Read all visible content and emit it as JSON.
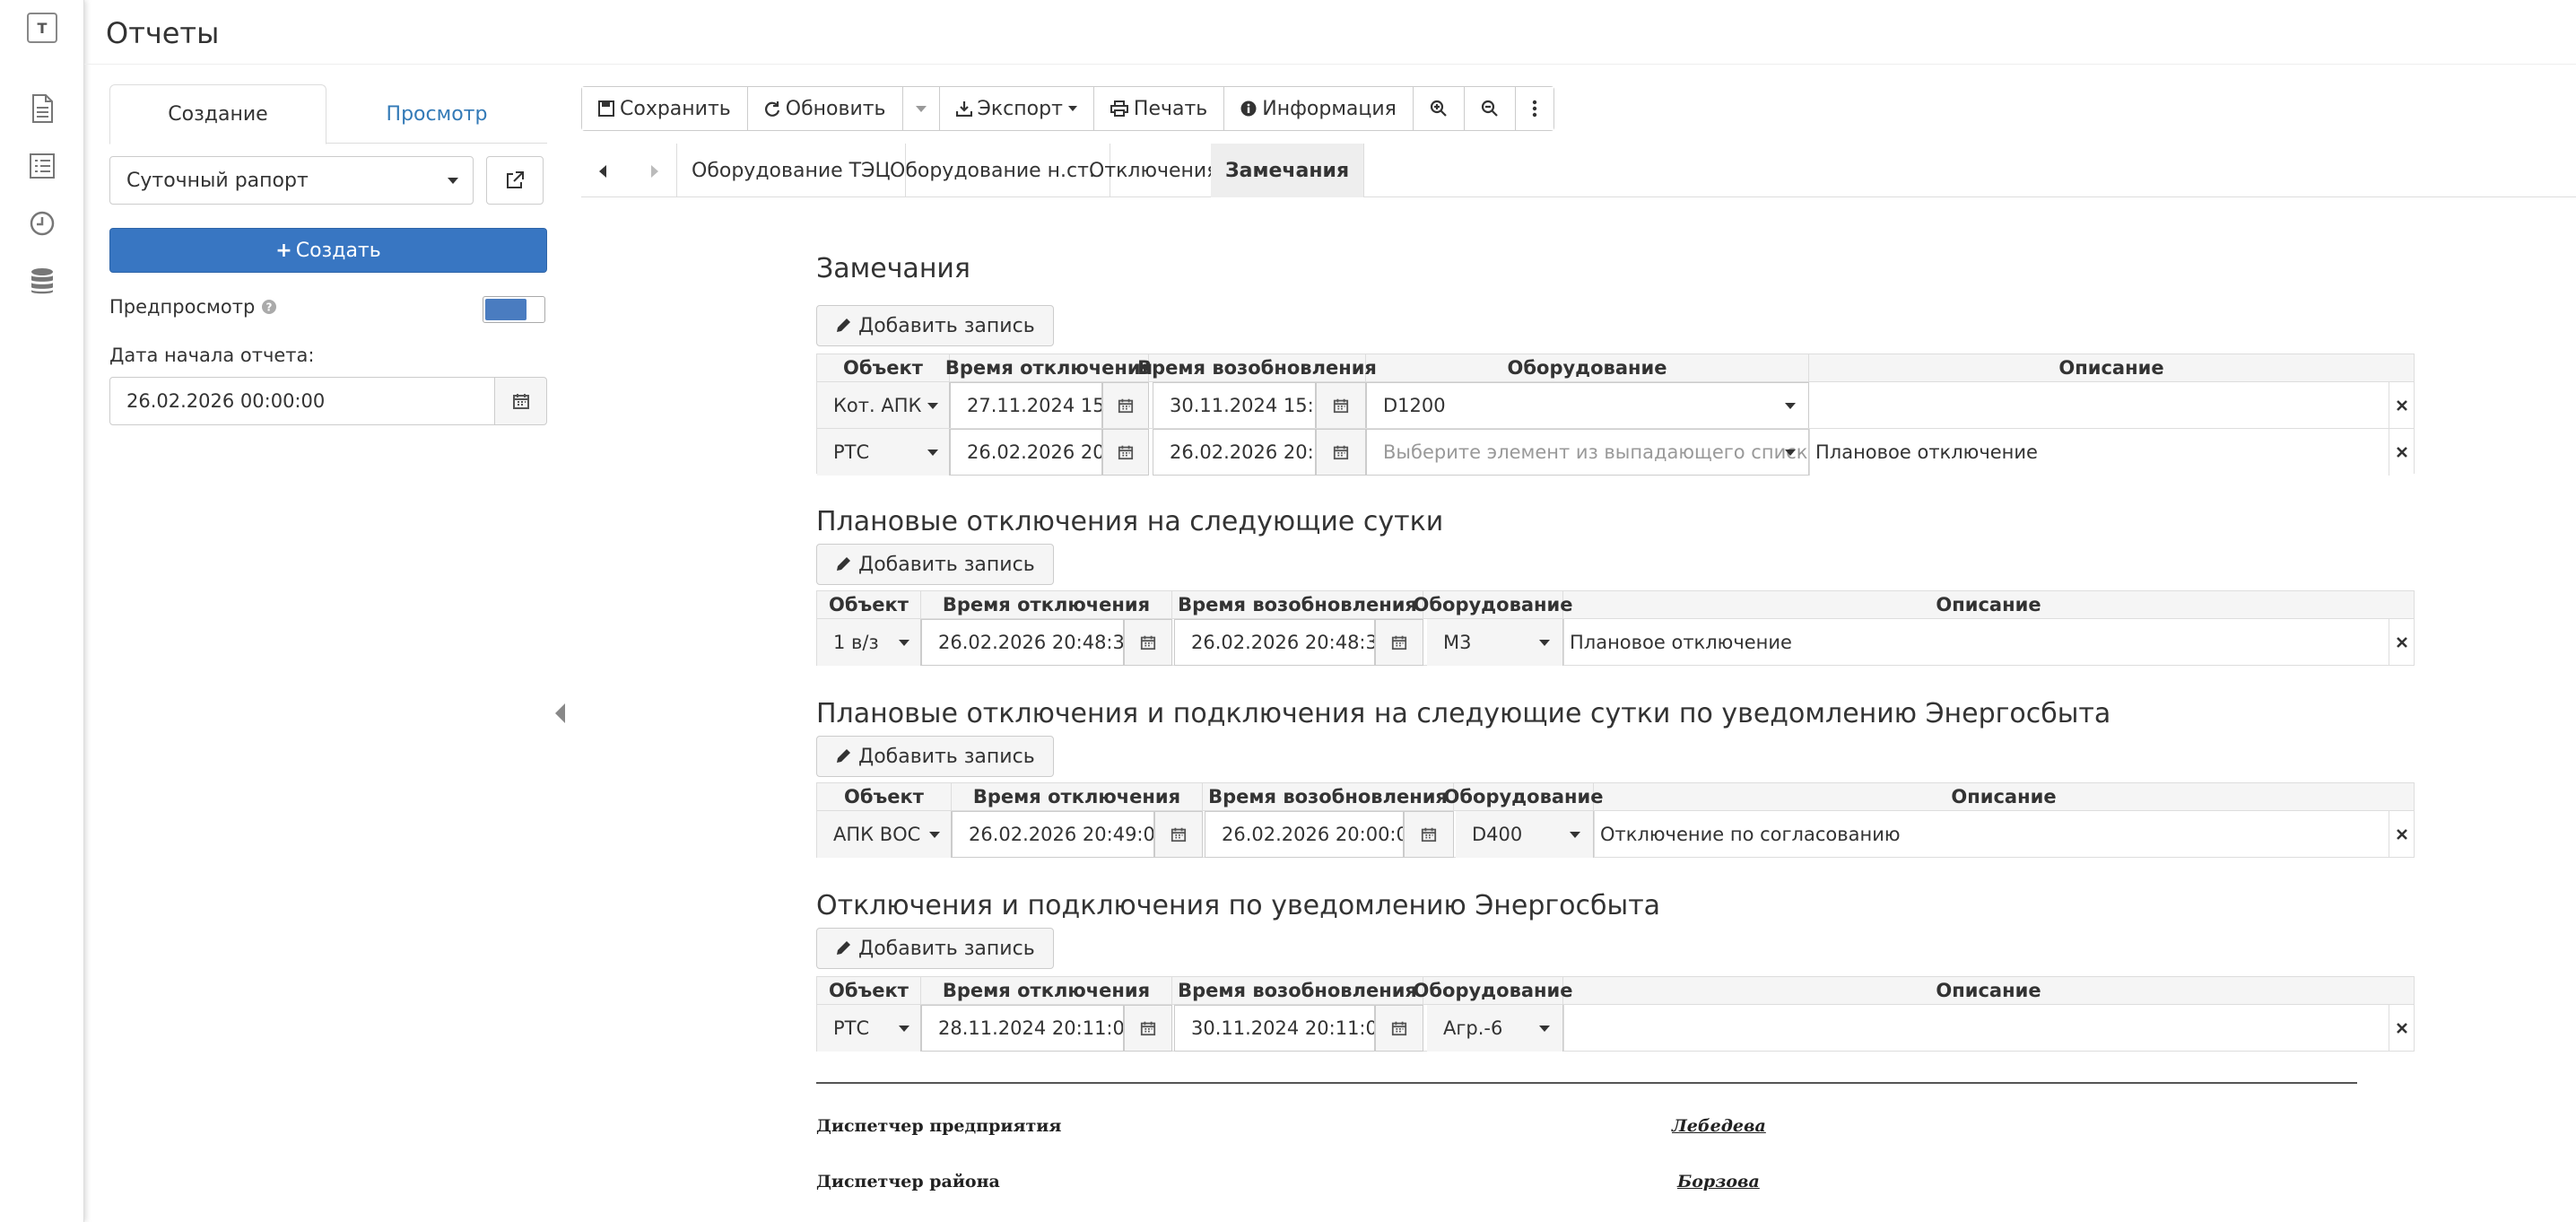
{
  "app": {
    "logo_letter": "T",
    "title": "Отчеты"
  },
  "rail": {
    "icons": [
      "document-icon",
      "list-icon",
      "clock-icon",
      "database-icon"
    ]
  },
  "sidebar": {
    "tabs": [
      {
        "label": "Создание",
        "active": true
      },
      {
        "label": "Просмотр",
        "active": false
      }
    ],
    "report_type": "Суточный рапорт",
    "create_label": "Создать",
    "preview_label": "Предпросмотр",
    "preview_enabled": true,
    "start_date_label": "Дата начала отчета:",
    "start_date_value": "26.02.2026 00:00:00"
  },
  "toolbar": {
    "save": "Сохранить",
    "refresh": "Обновить",
    "export": "Экспорт",
    "print": "Печать",
    "info": "Информация"
  },
  "report_tabs": [
    {
      "label": "Оборудование ТЭЦ",
      "active": false
    },
    {
      "label": "Оборудование н.ст.",
      "active": false
    },
    {
      "label": "Отключения",
      "active": false
    },
    {
      "label": "Замечания",
      "active": true
    }
  ],
  "add_record_label": "Добавить запись",
  "sections": [
    {
      "title": "Замечания",
      "headers": [
        "Объект",
        "Время отключения",
        "Время возобновления",
        "Оборудование",
        "Описание"
      ],
      "rows": [
        {
          "object": "Кот. АПК",
          "off_time": "27.11.2024 15",
          "on_time": "30.11.2024 15:",
          "equipment": "D1200",
          "description": ""
        },
        {
          "object": "РТС",
          "off_time": "26.02.2026 20",
          "on_time": "26.02.2026 20:",
          "equipment": "",
          "equipment_placeholder": "Выберите элемент из выпадающего списка...",
          "description": "Плановое отключение"
        }
      ]
    },
    {
      "title": "Плановые отключения на следующие сутки",
      "headers": [
        "Объект",
        "Время отключения",
        "Время возобновления",
        "Оборудование",
        "Описание"
      ],
      "rows": [
        {
          "object": "1 в/з",
          "off_time": "26.02.2026 20:48:3",
          "on_time": "26.02.2026 20:48:3",
          "equipment": "М3",
          "description": "Плановое отключение"
        }
      ]
    },
    {
      "title": "Плановые отключения и подключения на следующие сутки по уведомлению Энергосбыта",
      "headers": [
        "Объект",
        "Время отключения",
        "Время возобновления",
        "Оборудование",
        "Описание"
      ],
      "rows": [
        {
          "object": "АПК ВОС",
          "off_time": "26.02.2026 20:49:0",
          "on_time": "26.02.2026 20:00:0",
          "equipment": "D400",
          "description": "Отключение по согласованию"
        }
      ]
    },
    {
      "title": "Отключения и подключения по уведомлению Энергосбыта",
      "headers": [
        "Объект",
        "Время отключения",
        "Время возобновления",
        "Оборудование",
        "Описание"
      ],
      "rows": [
        {
          "object": "РТС",
          "off_time": "28.11.2024 20:11:0",
          "on_time": "30.11.2024 20:11:0",
          "equipment": "Агр.-6",
          "description": ""
        }
      ]
    }
  ],
  "signatures": [
    {
      "role": "Диспетчер предприятия",
      "name": "Лебедева"
    },
    {
      "role": "Диспетчер района",
      "name": "Борзова"
    }
  ]
}
